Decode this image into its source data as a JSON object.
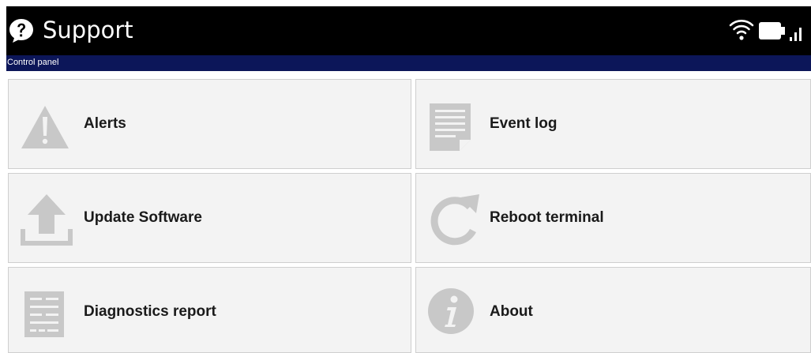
{
  "header": {
    "title": "Support",
    "app_icon": "question-icon",
    "status_icons": [
      "wifi-icon",
      "battery-icon",
      "signal-icon"
    ],
    "background_color": "#000000"
  },
  "subheader": {
    "breadcrumb": "Control panel",
    "background_color": "#0c1659"
  },
  "menu": {
    "items": [
      {
        "label": "Alerts",
        "icon": "warning-icon"
      },
      {
        "label": "Event log",
        "icon": "document-icon"
      },
      {
        "label": "Update Software",
        "icon": "upload-icon"
      },
      {
        "label": "Reboot terminal",
        "icon": "reboot-icon"
      },
      {
        "label": "Diagnostics report",
        "icon": "report-icon"
      },
      {
        "label": "About",
        "icon": "info-icon"
      }
    ],
    "tile_color": "#f3f3f3",
    "icon_color": "#c8c8c8"
  }
}
